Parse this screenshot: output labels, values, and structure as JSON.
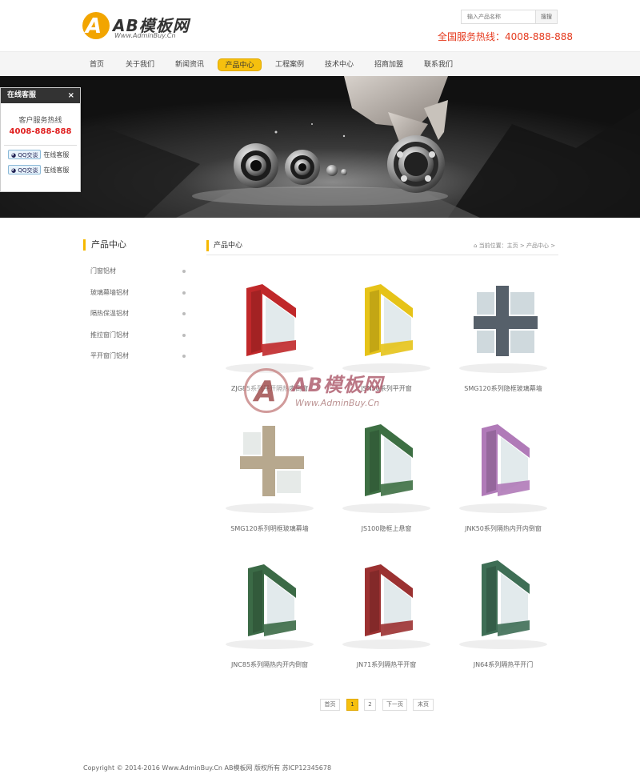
{
  "header": {
    "logo_title": "AB模板网",
    "logo_sub": "Www.AdminBuy.Cn",
    "search_placeholder": "输入产品名称",
    "search_button": "搜搜",
    "hotline": "全国服务热线：4008-888-888"
  },
  "nav": {
    "items": [
      "首页",
      "关于我们",
      "新闻资讯",
      "产品中心",
      "工程案例",
      "技术中心",
      "招商加盟",
      "联系我们"
    ],
    "active": "产品中心"
  },
  "service": {
    "title": "在线客服",
    "close": "×",
    "label": "客户服务热线",
    "phone": "4008-888-888",
    "qq": [
      {
        "badge": "QQ交谈",
        "text": "在线客服"
      },
      {
        "badge": "QQ交谈",
        "text": "在线客服"
      }
    ]
  },
  "sidebar": {
    "title": "产品中心",
    "items": [
      "门窗铝材",
      "玻璃幕墙铝材",
      "隔热保温铝材",
      "推拉窗门铝材",
      "平开窗门铝材"
    ]
  },
  "main": {
    "title": "产品中心",
    "breadcrumb": "当前位置：主页 > 产品中心 >"
  },
  "products": [
    {
      "name": "ZJG85系列平开隔热内倒窗",
      "color": "#c0282a"
    },
    {
      "name": "JSN50系列平开窗",
      "color": "#e6c318"
    },
    {
      "name": "SMG120系列隐框玻璃幕墙",
      "color": "#56606a"
    },
    {
      "name": "SMG120系列明框玻璃幕墙",
      "color": "#b7a88e"
    },
    {
      "name": "JS100隐框上悬窗",
      "color": "#3d6f43"
    },
    {
      "name": "JNK50系列隔热内开内倒窗",
      "color": "#b07ab8"
    },
    {
      "name": "JNC85系列隔热内开内倒窗",
      "color": "#3b6a46"
    },
    {
      "name": "JN71系列隔热平开窗",
      "color": "#9b3131"
    },
    {
      "name": "JN64系列隔热平开门",
      "color": "#3e6e55"
    }
  ],
  "watermark": {
    "title": "AB模板网",
    "sub": "Www.AdminBuy.Cn"
  },
  "pager": {
    "first": "首页",
    "pages": [
      "1",
      "2"
    ],
    "current": "1",
    "next": "下一页",
    "last": "末页"
  },
  "footer": {
    "copyright": "Copyright © 2014-2016 Www.AdminBuy.Cn AB模板网 版权所有   苏ICP12345678"
  }
}
